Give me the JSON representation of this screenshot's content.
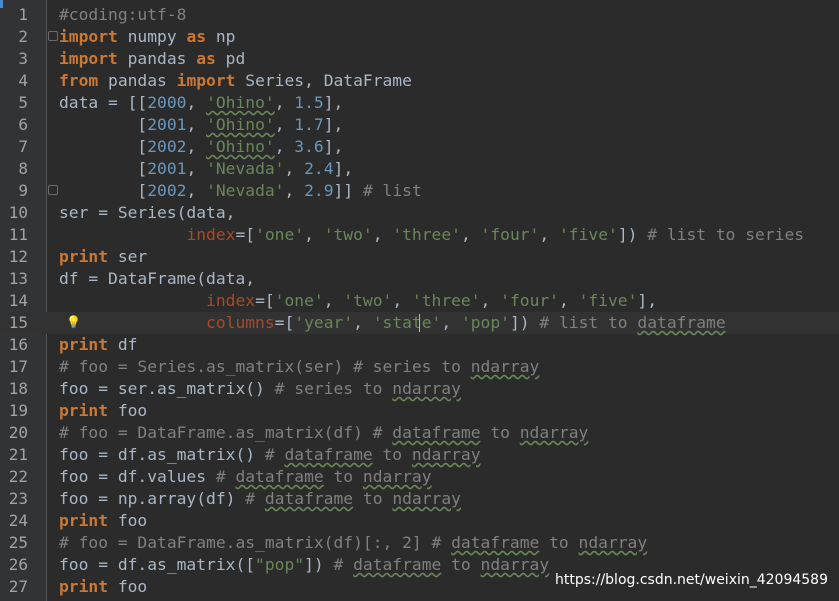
{
  "editor": {
    "watermark": "https://blog.csdn.net/weixin_42094589",
    "current_line": 15,
    "colors": {
      "background": "#2b2b2b",
      "gutter": "#313335",
      "keyword": "#cc7832",
      "string": "#6a8759",
      "number": "#6897bb",
      "comment": "#808080",
      "parameter": "#aa4926",
      "text": "#a9b7c6"
    },
    "icons": [
      "intention-bulb-icon",
      "fold-marker-icon"
    ],
    "lines": [
      {
        "n": "1",
        "tokens": [
          {
            "t": "#coding:utf-8",
            "c": "cmt"
          }
        ]
      },
      {
        "n": "2",
        "tokens": [
          {
            "t": "import",
            "c": "kw"
          },
          {
            "t": " numpy "
          },
          {
            "t": "as",
            "c": "kw"
          },
          {
            "t": " np"
          }
        ]
      },
      {
        "n": "3",
        "tokens": [
          {
            "t": "import",
            "c": "kw"
          },
          {
            "t": " pandas "
          },
          {
            "t": "as",
            "c": "kw"
          },
          {
            "t": " pd"
          }
        ]
      },
      {
        "n": "4",
        "tokens": [
          {
            "t": "from",
            "c": "kw"
          },
          {
            "t": " pandas "
          },
          {
            "t": "import",
            "c": "kw"
          },
          {
            "t": " Series, DataFrame"
          }
        ]
      },
      {
        "n": "5",
        "tokens": [
          {
            "t": "data = [["
          },
          {
            "t": "2000",
            "c": "num"
          },
          {
            "t": ", "
          },
          {
            "t": "'Ohino'",
            "c": "str typo"
          },
          {
            "t": ", "
          },
          {
            "t": "1.5",
            "c": "num"
          },
          {
            "t": "],"
          }
        ]
      },
      {
        "n": "6",
        "tokens": [
          {
            "t": "        ",
            "c": "dot"
          },
          {
            "t": "["
          },
          {
            "t": "2001",
            "c": "num"
          },
          {
            "t": ", "
          },
          {
            "t": "'Ohino'",
            "c": "str typo"
          },
          {
            "t": ", "
          },
          {
            "t": "1.7",
            "c": "num"
          },
          {
            "t": "],"
          }
        ]
      },
      {
        "n": "7",
        "tokens": [
          {
            "t": "        ",
            "c": "dot"
          },
          {
            "t": "["
          },
          {
            "t": "2002",
            "c": "num"
          },
          {
            "t": ", "
          },
          {
            "t": "'Ohino'",
            "c": "str typo"
          },
          {
            "t": ", "
          },
          {
            "t": "3.6",
            "c": "num"
          },
          {
            "t": "],"
          }
        ]
      },
      {
        "n": "8",
        "tokens": [
          {
            "t": "        ",
            "c": "dot"
          },
          {
            "t": "["
          },
          {
            "t": "2001",
            "c": "num"
          },
          {
            "t": ", "
          },
          {
            "t": "'Nevada'",
            "c": "str"
          },
          {
            "t": ", "
          },
          {
            "t": "2.4",
            "c": "num"
          },
          {
            "t": "],"
          }
        ]
      },
      {
        "n": "9",
        "tokens": [
          {
            "t": "        ",
            "c": "dot"
          },
          {
            "t": "["
          },
          {
            "t": "2002",
            "c": "num"
          },
          {
            "t": ", "
          },
          {
            "t": "'Nevada'",
            "c": "str"
          },
          {
            "t": ", "
          },
          {
            "t": "2.9",
            "c": "num"
          },
          {
            "t": "]] "
          },
          {
            "t": "# list",
            "c": "cmt"
          }
        ]
      },
      {
        "n": "10",
        "tokens": [
          {
            "t": "ser = Series(data,"
          }
        ]
      },
      {
        "n": "11",
        "tokens": [
          {
            "t": "             ",
            "c": "dot"
          },
          {
            "t": "index",
            "c": "par"
          },
          {
            "t": "=["
          },
          {
            "t": "'one'",
            "c": "str"
          },
          {
            "t": ", "
          },
          {
            "t": "'two'",
            "c": "str"
          },
          {
            "t": ", "
          },
          {
            "t": "'three'",
            "c": "str"
          },
          {
            "t": ", "
          },
          {
            "t": "'four'",
            "c": "str"
          },
          {
            "t": ", "
          },
          {
            "t": "'five'",
            "c": "str"
          },
          {
            "t": "]) "
          },
          {
            "t": "# list to series",
            "c": "cmt"
          }
        ]
      },
      {
        "n": "12",
        "tokens": [
          {
            "t": "print",
            "c": "kw"
          },
          {
            "t": " ser"
          }
        ]
      },
      {
        "n": "13",
        "tokens": [
          {
            "t": "df = DataFrame(data,"
          }
        ]
      },
      {
        "n": "14",
        "tokens": [
          {
            "t": "               ",
            "c": "dot"
          },
          {
            "t": "index",
            "c": "par"
          },
          {
            "t": "=["
          },
          {
            "t": "'one'",
            "c": "str"
          },
          {
            "t": ", "
          },
          {
            "t": "'two'",
            "c": "str"
          },
          {
            "t": ", "
          },
          {
            "t": "'three'",
            "c": "str"
          },
          {
            "t": ", "
          },
          {
            "t": "'four'",
            "c": "str"
          },
          {
            "t": ", "
          },
          {
            "t": "'five'",
            "c": "str"
          },
          {
            "t": "],"
          }
        ]
      },
      {
        "n": "15",
        "tokens": [
          {
            "t": "               ",
            "c": "dot"
          },
          {
            "t": "columns",
            "c": "par"
          },
          {
            "t": "=["
          },
          {
            "t": "'year'",
            "c": "str"
          },
          {
            "t": ", "
          },
          {
            "t": "'state'",
            "c": "str"
          },
          {
            "t": ", "
          },
          {
            "t": "'pop'",
            "c": "str"
          },
          {
            "t": "]) "
          },
          {
            "t": "# list to ",
            "c": "cmt"
          },
          {
            "t": "dataframe",
            "c": "cmt typo"
          }
        ]
      },
      {
        "n": "16",
        "tokens": [
          {
            "t": "print",
            "c": "kw"
          },
          {
            "t": " df"
          }
        ]
      },
      {
        "n": "17",
        "tokens": [
          {
            "t": "# foo = Series.as_matrix(ser) # series to ",
            "c": "cmt"
          },
          {
            "t": "ndarray",
            "c": "cmt typo"
          }
        ]
      },
      {
        "n": "18",
        "tokens": [
          {
            "t": "foo = ser.as_matrix() "
          },
          {
            "t": "# series to ",
            "c": "cmt"
          },
          {
            "t": "ndarray",
            "c": "cmt typo"
          }
        ]
      },
      {
        "n": "19",
        "tokens": [
          {
            "t": "print",
            "c": "kw"
          },
          {
            "t": " foo"
          }
        ]
      },
      {
        "n": "20",
        "tokens": [
          {
            "t": "# foo = DataFrame.as_matrix(df) # ",
            "c": "cmt"
          },
          {
            "t": "dataframe",
            "c": "cmt typo"
          },
          {
            "t": " to ",
            "c": "cmt"
          },
          {
            "t": "ndarray",
            "c": "cmt typo"
          }
        ]
      },
      {
        "n": "21",
        "tokens": [
          {
            "t": "foo = df.as_matrix() "
          },
          {
            "t": "# ",
            "c": "cmt"
          },
          {
            "t": "dataframe",
            "c": "cmt typo"
          },
          {
            "t": " to ",
            "c": "cmt"
          },
          {
            "t": "ndarray",
            "c": "cmt typo"
          }
        ]
      },
      {
        "n": "22",
        "tokens": [
          {
            "t": "foo = df.values "
          },
          {
            "t": "# ",
            "c": "cmt"
          },
          {
            "t": "dataframe",
            "c": "cmt typo"
          },
          {
            "t": " to ",
            "c": "cmt"
          },
          {
            "t": "ndarray",
            "c": "cmt typo"
          }
        ]
      },
      {
        "n": "23",
        "tokens": [
          {
            "t": "foo = np.array(df) "
          },
          {
            "t": "# ",
            "c": "cmt"
          },
          {
            "t": "dataframe",
            "c": "cmt typo"
          },
          {
            "t": " to ",
            "c": "cmt"
          },
          {
            "t": "ndarray",
            "c": "cmt typo"
          }
        ]
      },
      {
        "n": "24",
        "tokens": [
          {
            "t": "print",
            "c": "kw"
          },
          {
            "t": " foo"
          }
        ]
      },
      {
        "n": "25",
        "tokens": [
          {
            "t": "# foo = DataFrame.as_matrix(df)[:, 2] # ",
            "c": "cmt"
          },
          {
            "t": "dataframe",
            "c": "cmt typo"
          },
          {
            "t": " to ",
            "c": "cmt"
          },
          {
            "t": "ndarray",
            "c": "cmt typo"
          }
        ]
      },
      {
        "n": "26",
        "tokens": [
          {
            "t": "foo = df.as_matrix(["
          },
          {
            "t": "\"pop\"",
            "c": "str"
          },
          {
            "t": "]) "
          },
          {
            "t": "# ",
            "c": "cmt"
          },
          {
            "t": "dataframe",
            "c": "cmt typo"
          },
          {
            "t": " to ",
            "c": "cmt"
          },
          {
            "t": "ndarray",
            "c": "cmt typo"
          }
        ]
      },
      {
        "n": "27",
        "tokens": [
          {
            "t": "print",
            "c": "kw"
          },
          {
            "t": " foo"
          }
        ]
      }
    ]
  }
}
